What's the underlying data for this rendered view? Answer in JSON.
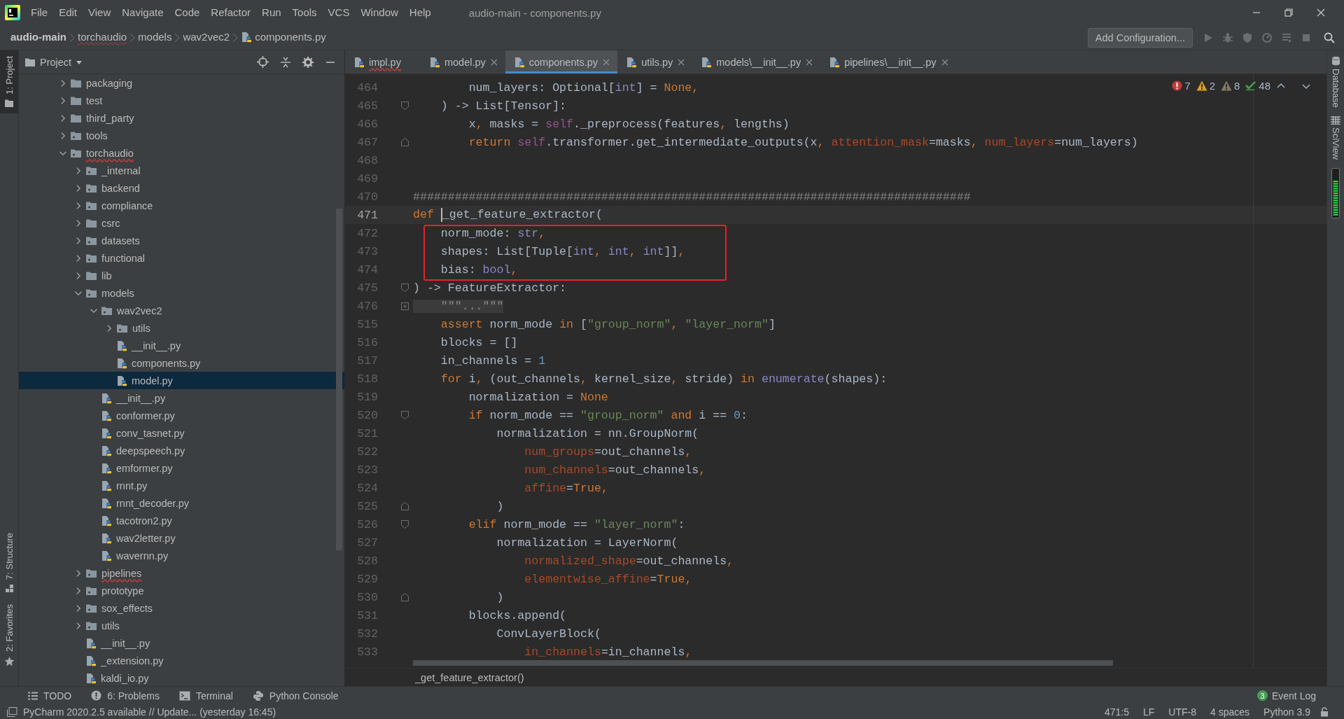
{
  "title_bar": {
    "menu": [
      "File",
      "Edit",
      "View",
      "Navigate",
      "Code",
      "Refactor",
      "Run",
      "Tools",
      "VCS",
      "Window",
      "Help"
    ],
    "title": "audio-main - components.py"
  },
  "nav_bar": {
    "breadcrumbs": [
      {
        "label": "audio-main",
        "kind": "project",
        "error": false
      },
      {
        "label": "torchaudio",
        "kind": "folder",
        "error": true
      },
      {
        "label": "models",
        "kind": "folder",
        "error": false
      },
      {
        "label": "wav2vec2",
        "kind": "folder",
        "error": false
      },
      {
        "label": "components.py",
        "kind": "file",
        "error": false
      }
    ],
    "config_button": "Add Configuration..."
  },
  "left_stripe": {
    "top": [
      {
        "label": "1: Project",
        "kind": "project",
        "selected": true
      }
    ],
    "bottom": [
      {
        "label": "7: Structure",
        "kind": "structure",
        "selected": false
      },
      {
        "label": "2: Favorites",
        "kind": "favorites",
        "selected": false
      }
    ]
  },
  "project": {
    "title": "Project",
    "tree": [
      {
        "name": "packaging",
        "kind": "folder",
        "expanded": false,
        "selected": false,
        "error": false
      },
      {
        "name": "test",
        "kind": "folder",
        "expanded": false,
        "selected": false,
        "error": false
      },
      {
        "name": "third_party",
        "kind": "folder",
        "expanded": false,
        "selected": false,
        "error": false
      },
      {
        "name": "tools",
        "kind": "package",
        "expanded": false,
        "selected": false,
        "error": false
      },
      {
        "name": "torchaudio",
        "kind": "package",
        "expanded": true,
        "selected": false,
        "error": true,
        "children": [
          {
            "name": "_internal",
            "kind": "package",
            "expanded": false,
            "selected": false,
            "error": false
          },
          {
            "name": "backend",
            "kind": "package",
            "expanded": false,
            "selected": false,
            "error": false
          },
          {
            "name": "compliance",
            "kind": "package",
            "expanded": false,
            "selected": false,
            "error": false
          },
          {
            "name": "csrc",
            "kind": "folder",
            "expanded": false,
            "selected": false,
            "error": false
          },
          {
            "name": "datasets",
            "kind": "package",
            "expanded": false,
            "selected": false,
            "error": false
          },
          {
            "name": "functional",
            "kind": "package",
            "expanded": false,
            "selected": false,
            "error": false
          },
          {
            "name": "lib",
            "kind": "folder",
            "expanded": false,
            "selected": false,
            "error": false
          },
          {
            "name": "models",
            "kind": "package",
            "expanded": true,
            "selected": false,
            "error": false,
            "children": [
              {
                "name": "wav2vec2",
                "kind": "package",
                "expanded": true,
                "selected": false,
                "error": false,
                "children": [
                  {
                    "name": "utils",
                    "kind": "package",
                    "expanded": false,
                    "selected": false,
                    "error": false
                  },
                  {
                    "name": "__init__.py",
                    "kind": "python",
                    "selected": false,
                    "error": false
                  },
                  {
                    "name": "components.py",
                    "kind": "python",
                    "selected": false,
                    "error": false
                  },
                  {
                    "name": "model.py",
                    "kind": "python",
                    "selected": true,
                    "error": false
                  }
                ]
              },
              {
                "name": "__init__.py",
                "kind": "python",
                "selected": false,
                "error": false
              },
              {
                "name": "conformer.py",
                "kind": "python",
                "selected": false,
                "error": false
              },
              {
                "name": "conv_tasnet.py",
                "kind": "python",
                "selected": false,
                "error": false
              },
              {
                "name": "deepspeech.py",
                "kind": "python",
                "selected": false,
                "error": false
              },
              {
                "name": "emformer.py",
                "kind": "python",
                "selected": false,
                "error": false
              },
              {
                "name": "rnnt.py",
                "kind": "python",
                "selected": false,
                "error": false
              },
              {
                "name": "rnnt_decoder.py",
                "kind": "python",
                "selected": false,
                "error": false
              },
              {
                "name": "tacotron2.py",
                "kind": "python",
                "selected": false,
                "error": false
              },
              {
                "name": "wav2letter.py",
                "kind": "python",
                "selected": false,
                "error": false
              },
              {
                "name": "wavernn.py",
                "kind": "python",
                "selected": false,
                "error": false
              }
            ]
          },
          {
            "name": "pipelines",
            "kind": "package",
            "expanded": false,
            "selected": false,
            "error": true
          },
          {
            "name": "prototype",
            "kind": "package",
            "expanded": false,
            "selected": false,
            "error": false
          },
          {
            "name": "sox_effects",
            "kind": "package",
            "expanded": false,
            "selected": false,
            "error": false
          },
          {
            "name": "utils",
            "kind": "package",
            "expanded": false,
            "selected": false,
            "error": false
          },
          {
            "name": "__init__.py",
            "kind": "python",
            "selected": false,
            "error": false
          },
          {
            "name": "_extension.py",
            "kind": "python",
            "selected": false,
            "error": false
          },
          {
            "name": "kaldi_io.py",
            "kind": "python",
            "selected": false,
            "error": false
          }
        ]
      }
    ]
  },
  "tabs": [
    {
      "label": "impl.py",
      "selected": false,
      "error": true,
      "closable": false
    },
    {
      "label": "model.py",
      "selected": false,
      "error": false,
      "closable": true
    },
    {
      "label": "components.py",
      "selected": true,
      "error": false,
      "closable": true
    },
    {
      "label": "utils.py",
      "selected": false,
      "error": false,
      "closable": true
    },
    {
      "label": "models\\__init__.py",
      "selected": false,
      "error": false,
      "closable": true
    },
    {
      "label": "pipelines\\__init__.py",
      "selected": false,
      "error": false,
      "closable": true
    }
  ],
  "inspections": [
    {
      "kind": "error",
      "count": "7"
    },
    {
      "kind": "warning",
      "count": "2"
    },
    {
      "kind": "weak",
      "count": "8"
    },
    {
      "kind": "typo",
      "count": "48"
    }
  ],
  "code_lines": [
    {
      "number": "464",
      "kind": "plain",
      "current": false,
      "boxed": false,
      "tokens": [
        {
          "kind": "plain",
          "text": "        num_layers: Optional["
        },
        {
          "kind": "builtin",
          "text": "int"
        },
        {
          "kind": "plain",
          "text": "] = "
        },
        {
          "kind": "keyword",
          "text": "None,"
        }
      ]
    },
    {
      "number": "465",
      "kind": "fold_start",
      "current": false,
      "boxed": false,
      "tokens": [
        {
          "kind": "plain",
          "text": "    ) -> List[Tensor]:"
        }
      ]
    },
    {
      "number": "466",
      "kind": "plain",
      "current": false,
      "boxed": false,
      "tokens": [
        {
          "kind": "plain",
          "text": "        x"
        },
        {
          "kind": "keyword",
          "text": ","
        },
        {
          "kind": "plain",
          "text": " masks = "
        },
        {
          "kind": "self",
          "text": "self"
        },
        {
          "kind": "plain",
          "text": "._preprocess(features"
        },
        {
          "kind": "keyword",
          "text": ","
        },
        {
          "kind": "plain",
          "text": " lengths)"
        }
      ]
    },
    {
      "number": "467",
      "kind": "fold_end",
      "current": false,
      "boxed": false,
      "tokens": [
        {
          "kind": "keyword",
          "text": "        return "
        },
        {
          "kind": "self",
          "text": "self"
        },
        {
          "kind": "plain",
          "text": ".transformer.get_intermediate_outputs(x"
        },
        {
          "kind": "keyword",
          "text": ", "
        },
        {
          "kind": "param",
          "text": "attention_mask"
        },
        {
          "kind": "plain",
          "text": "=masks"
        },
        {
          "kind": "keyword",
          "text": ", "
        },
        {
          "kind": "param",
          "text": "num_layers"
        },
        {
          "kind": "plain",
          "text": "=num_layers)"
        }
      ]
    },
    {
      "number": "468",
      "kind": "plain",
      "current": false,
      "boxed": false
    },
    {
      "number": "469",
      "kind": "plain",
      "current": false,
      "boxed": false
    },
    {
      "number": "470",
      "kind": "plain",
      "current": false,
      "boxed": false,
      "tokens": [
        {
          "kind": "comment",
          "text": "################################################################################"
        }
      ]
    },
    {
      "number": "471",
      "kind": "plain",
      "current": true,
      "boxed": false,
      "tokens": [
        {
          "kind": "keyword",
          "text": "def "
        },
        {
          "kind": "plain",
          "text": "_get_feature_extractor("
        }
      ]
    },
    {
      "number": "472",
      "kind": "plain",
      "current": false,
      "boxed": true,
      "tokens": [
        {
          "kind": "plain",
          "text": "    norm_mode: "
        },
        {
          "kind": "builtin",
          "text": "str"
        },
        {
          "kind": "keyword",
          "text": ","
        }
      ]
    },
    {
      "number": "473",
      "kind": "plain",
      "current": false,
      "boxed": true,
      "tokens": [
        {
          "kind": "plain",
          "text": "    shapes: List[Tuple["
        },
        {
          "kind": "builtin",
          "text": "int"
        },
        {
          "kind": "keyword",
          "text": ", "
        },
        {
          "kind": "builtin",
          "text": "int"
        },
        {
          "kind": "keyword",
          "text": ", "
        },
        {
          "kind": "builtin",
          "text": "int"
        },
        {
          "kind": "plain",
          "text": "]]"
        },
        {
          "kind": "keyword",
          "text": ","
        }
      ]
    },
    {
      "number": "474",
      "kind": "plain",
      "current": false,
      "boxed": true,
      "tokens": [
        {
          "kind": "plain",
          "text": "    bias: "
        },
        {
          "kind": "builtin",
          "text": "bool"
        },
        {
          "kind": "keyword",
          "text": ","
        }
      ]
    },
    {
      "number": "475",
      "kind": "fold_start",
      "current": false,
      "boxed": false,
      "tokens": [
        {
          "kind": "plain",
          "text": ") -> FeatureExtractor:"
        }
      ]
    },
    {
      "number": "476",
      "kind": "folded",
      "current": false,
      "boxed": false,
      "tokens": [
        {
          "kind": "folded",
          "text": "    \"\"\"...\"\"\""
        }
      ]
    },
    {
      "number": "515",
      "kind": "plain",
      "current": false,
      "boxed": false,
      "tokens": [
        {
          "kind": "keyword",
          "text": "    assert "
        },
        {
          "kind": "plain",
          "text": "norm_mode "
        },
        {
          "kind": "keyword",
          "text": "in "
        },
        {
          "kind": "plain",
          "text": "["
        },
        {
          "kind": "string",
          "text": "\"group_norm\""
        },
        {
          "kind": "keyword",
          "text": ", "
        },
        {
          "kind": "string",
          "text": "\"layer_norm\""
        },
        {
          "kind": "plain",
          "text": "]"
        }
      ]
    },
    {
      "number": "516",
      "kind": "plain",
      "current": false,
      "boxed": false,
      "tokens": [
        {
          "kind": "plain",
          "text": "    blocks = []"
        }
      ]
    },
    {
      "number": "517",
      "kind": "plain",
      "current": false,
      "boxed": false,
      "tokens": [
        {
          "kind": "plain",
          "text": "    in_channels = "
        },
        {
          "kind": "number",
          "text": "1"
        }
      ]
    },
    {
      "number": "518",
      "kind": "plain",
      "current": false,
      "boxed": false,
      "tokens": [
        {
          "kind": "keyword",
          "text": "    for "
        },
        {
          "kind": "plain",
          "text": "i"
        },
        {
          "kind": "keyword",
          "text": ", "
        },
        {
          "kind": "plain",
          "text": "(out_channels"
        },
        {
          "kind": "keyword",
          "text": ", "
        },
        {
          "kind": "plain",
          "text": "kernel_size"
        },
        {
          "kind": "keyword",
          "text": ", "
        },
        {
          "kind": "plain",
          "text": "stride) "
        },
        {
          "kind": "keyword",
          "text": "in "
        },
        {
          "kind": "builtin",
          "text": "enumerate"
        },
        {
          "kind": "plain",
          "text": "(shapes):"
        }
      ]
    },
    {
      "number": "519",
      "kind": "plain",
      "current": false,
      "boxed": false,
      "tokens": [
        {
          "kind": "plain",
          "text": "        normalization = "
        },
        {
          "kind": "keyword",
          "text": "None"
        }
      ]
    },
    {
      "number": "520",
      "kind": "fold_start",
      "current": false,
      "boxed": false,
      "tokens": [
        {
          "kind": "keyword",
          "text": "        if "
        },
        {
          "kind": "plain",
          "text": "norm_mode == "
        },
        {
          "kind": "string",
          "text": "\"group_norm\" "
        },
        {
          "kind": "keyword",
          "text": "and "
        },
        {
          "kind": "plain",
          "text": "i == "
        },
        {
          "kind": "number",
          "text": "0"
        },
        {
          "kind": "plain",
          "text": ":"
        }
      ]
    },
    {
      "number": "521",
      "kind": "plain",
      "current": false,
      "boxed": false,
      "tokens": [
        {
          "kind": "plain",
          "text": "            normalization = nn.GroupNorm("
        }
      ]
    },
    {
      "number": "522",
      "kind": "plain",
      "current": false,
      "boxed": false,
      "tokens": [
        {
          "kind": "param",
          "text": "                num_groups"
        },
        {
          "kind": "plain",
          "text": "=out_channels"
        },
        {
          "kind": "keyword",
          "text": ","
        }
      ]
    },
    {
      "number": "523",
      "kind": "plain",
      "current": false,
      "boxed": false,
      "tokens": [
        {
          "kind": "param",
          "text": "                num_channels"
        },
        {
          "kind": "plain",
          "text": "=out_channels"
        },
        {
          "kind": "keyword",
          "text": ","
        }
      ]
    },
    {
      "number": "524",
      "kind": "plain",
      "current": false,
      "boxed": false,
      "tokens": [
        {
          "kind": "param",
          "text": "                affine"
        },
        {
          "kind": "plain",
          "text": "="
        },
        {
          "kind": "keyword",
          "text": "True,"
        }
      ]
    },
    {
      "number": "525",
      "kind": "fold_end",
      "current": false,
      "boxed": false,
      "tokens": [
        {
          "kind": "plain",
          "text": "            )"
        }
      ]
    },
    {
      "number": "526",
      "kind": "fold_start",
      "current": false,
      "boxed": false,
      "tokens": [
        {
          "kind": "keyword",
          "text": "        elif "
        },
        {
          "kind": "plain",
          "text": "norm_mode == "
        },
        {
          "kind": "string",
          "text": "\"layer_norm\""
        },
        {
          "kind": "plain",
          "text": ":"
        }
      ]
    },
    {
      "number": "527",
      "kind": "plain",
      "current": false,
      "boxed": false,
      "tokens": [
        {
          "kind": "plain",
          "text": "            normalization = LayerNorm("
        }
      ]
    },
    {
      "number": "528",
      "kind": "plain",
      "current": false,
      "boxed": false,
      "tokens": [
        {
          "kind": "param",
          "text": "                normalized_shape"
        },
        {
          "kind": "plain",
          "text": "=out_channels"
        },
        {
          "kind": "keyword",
          "text": ","
        }
      ]
    },
    {
      "number": "529",
      "kind": "plain",
      "current": false,
      "boxed": false,
      "tokens": [
        {
          "kind": "param",
          "text": "                elementwise_affine"
        },
        {
          "kind": "plain",
          "text": "="
        },
        {
          "kind": "keyword",
          "text": "True,"
        }
      ]
    },
    {
      "number": "530",
      "kind": "fold_end",
      "current": false,
      "boxed": false,
      "tokens": [
        {
          "kind": "plain",
          "text": "            )"
        }
      ]
    },
    {
      "number": "531",
      "kind": "plain",
      "current": false,
      "boxed": false,
      "tokens": [
        {
          "kind": "plain",
          "text": "        blocks.append("
        }
      ]
    },
    {
      "number": "532",
      "kind": "plain",
      "current": false,
      "boxed": false,
      "tokens": [
        {
          "kind": "plain",
          "text": "            ConvLayerBlock("
        }
      ]
    },
    {
      "number": "533",
      "kind": "plain",
      "current": false,
      "boxed": false,
      "tokens": [
        {
          "kind": "param",
          "text": "                in_channels"
        },
        {
          "kind": "plain",
          "text": "=in_channels"
        },
        {
          "kind": "keyword",
          "text": ","
        }
      ]
    }
  ],
  "editor_breadcrumb": "_get_feature_extractor()",
  "right_stripe": [
    {
      "label": "Database",
      "kind": "database"
    },
    {
      "label": "SciView",
      "kind": "sciview"
    }
  ],
  "tool_windows": [
    {
      "label": "TODO",
      "kind": "todo"
    },
    {
      "label": "6: Problems",
      "kind": "problems"
    },
    {
      "label": "Terminal",
      "kind": "terminal"
    },
    {
      "label": "Python Console",
      "kind": "console"
    }
  ],
  "event_log": {
    "label": "Event Log",
    "count": "3"
  },
  "status_bar": {
    "message": "PyCharm 2020.2.5 available // Update... (yesterday 16:45)",
    "items": [
      "471:5",
      "LF",
      "UTF-8",
      "4 spaces",
      "Python 3.9"
    ]
  }
}
